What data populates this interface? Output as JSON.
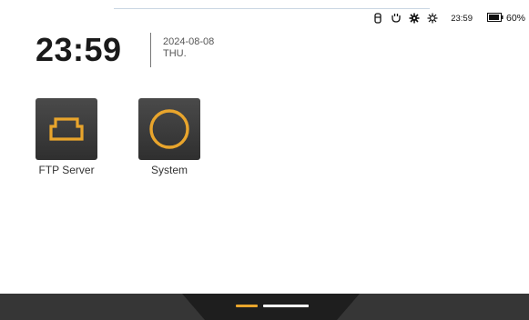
{
  "status": {
    "icons": [
      "usb-icon",
      "power-plug-icon",
      "settings-icon",
      "brightness-icon"
    ],
    "time": "23:59",
    "battery": "60%"
  },
  "clock": {
    "time": "23:59",
    "date": "2024-08-08",
    "weekday": "THU."
  },
  "apps": [
    {
      "label": "FTP Server",
      "icon": "ftp-server-icon"
    },
    {
      "label": "System",
      "icon": "system-icon"
    }
  ],
  "pager": {
    "pages": 2,
    "active_index": 0
  },
  "colors": {
    "accent": "#e9a52c",
    "tile_bg": "#3c3c3c",
    "dock": "#363636",
    "dock_center": "#1e1e1e",
    "inactive_dot": "#ffffff"
  }
}
